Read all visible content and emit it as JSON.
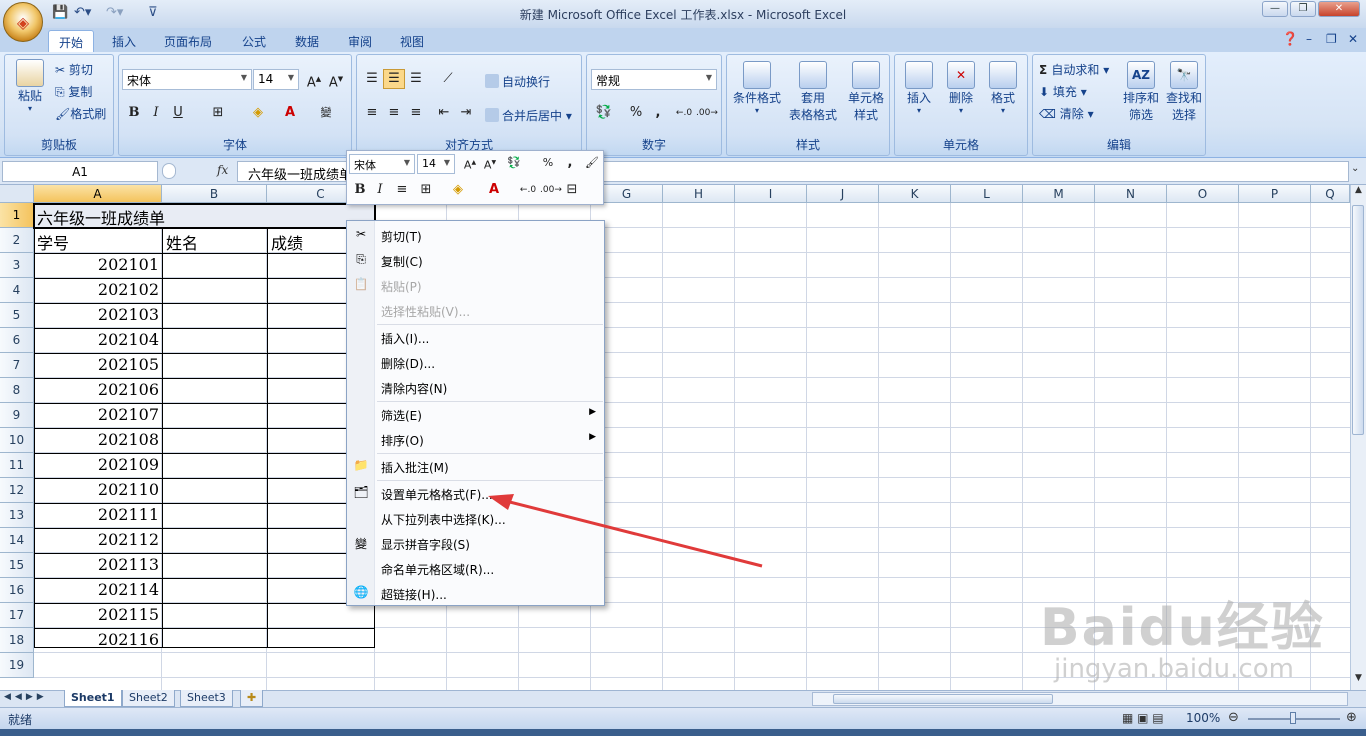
{
  "window": {
    "title": "新建 Microsoft Office Excel 工作表.xlsx - Microsoft Excel"
  },
  "ribbon_tabs": [
    "开始",
    "插入",
    "页面布局",
    "公式",
    "数据",
    "审阅",
    "视图"
  ],
  "clipboard": {
    "paste": "粘贴",
    "cut": "剪切",
    "copy": "复制",
    "format_painter": "格式刷",
    "label": "剪贴板"
  },
  "font": {
    "name": "宋体",
    "size": "14",
    "label": "字体",
    "bold": "B",
    "italic": "I",
    "underline": "U"
  },
  "alignment": {
    "wrap": "自动换行",
    "merge": "合并后居中",
    "label": "对齐方式"
  },
  "number": {
    "format": "常规",
    "percent": "%",
    "comma": ",",
    "label": "数字"
  },
  "styles": {
    "conditional": "条件格式",
    "table1": "套用",
    "table2": "表格格式",
    "cell1": "单元格",
    "cell2": "样式",
    "label": "样式"
  },
  "cells": {
    "insert": "插入",
    "delete": "删除",
    "format": "格式",
    "label": "单元格"
  },
  "editing": {
    "autosum": "自动求和",
    "fill": "填充",
    "clear": "清除",
    "sort1": "排序和",
    "sort2": "筛选",
    "find1": "查找和",
    "find2": "选择",
    "label": "编辑"
  },
  "formula_bar": {
    "name_box": "A1",
    "fx": "fx",
    "content": "六年级一班成绩单"
  },
  "columns": [
    "A",
    "B",
    "C",
    "D",
    "E",
    "F",
    "G",
    "H",
    "I",
    "J",
    "K",
    "L",
    "M",
    "N",
    "O",
    "P",
    "Q"
  ],
  "rows": [
    "1",
    "2",
    "3",
    "4",
    "5",
    "6",
    "7",
    "8",
    "9",
    "10",
    "11",
    "12",
    "13",
    "14",
    "15",
    "16",
    "17",
    "18",
    "19"
  ],
  "sheet": {
    "title": "六年级一班成绩单",
    "headers": [
      "学号",
      "姓名",
      "成绩"
    ],
    "ids": [
      "202101",
      "202102",
      "202103",
      "202104",
      "202105",
      "202106",
      "202107",
      "202108",
      "202109",
      "202110",
      "202111",
      "202112",
      "202113",
      "202114",
      "202115",
      "202116"
    ]
  },
  "mini_toolbar": {
    "font": "宋体",
    "size": "14",
    "percent": "%",
    "comma": ",",
    "bold": "B",
    "italic": "I"
  },
  "context_menu": {
    "items": [
      {
        "label": "剪切(T)",
        "icon": "scissors-icon"
      },
      {
        "label": "复制(C)",
        "icon": "copy-icon"
      },
      {
        "label": "粘贴(P)",
        "icon": "paste-icon",
        "disabled": true
      },
      {
        "label": "选择性粘贴(V)...",
        "disabled": true
      },
      {
        "label": "插入(I)..."
      },
      {
        "label": "删除(D)..."
      },
      {
        "label": "清除内容(N)"
      },
      {
        "label": "筛选(E)",
        "submenu": true
      },
      {
        "label": "排序(O)",
        "submenu": true
      },
      {
        "label": "插入批注(M)",
        "icon": "comment-icon"
      },
      {
        "label": "设置单元格格式(F)...",
        "icon": "format-cells-icon"
      },
      {
        "label": "从下拉列表中选择(K)..."
      },
      {
        "label": "显示拼音字段(S)",
        "icon": "phonetic-icon"
      },
      {
        "label": "命名单元格区域(R)..."
      },
      {
        "label": "超链接(H)...",
        "icon": "hyperlink-icon"
      }
    ]
  },
  "sheet_tabs": [
    "Sheet1",
    "Sheet2",
    "Sheet3"
  ],
  "status": {
    "ready": "就绪",
    "zoom": "100%"
  },
  "watermark": {
    "brand": "Baidu经验",
    "url": "jingyan.baidu.com"
  },
  "colors": {
    "accent": "#15428b",
    "arrow": "#e03a3a",
    "selection": "#f4c35d"
  }
}
